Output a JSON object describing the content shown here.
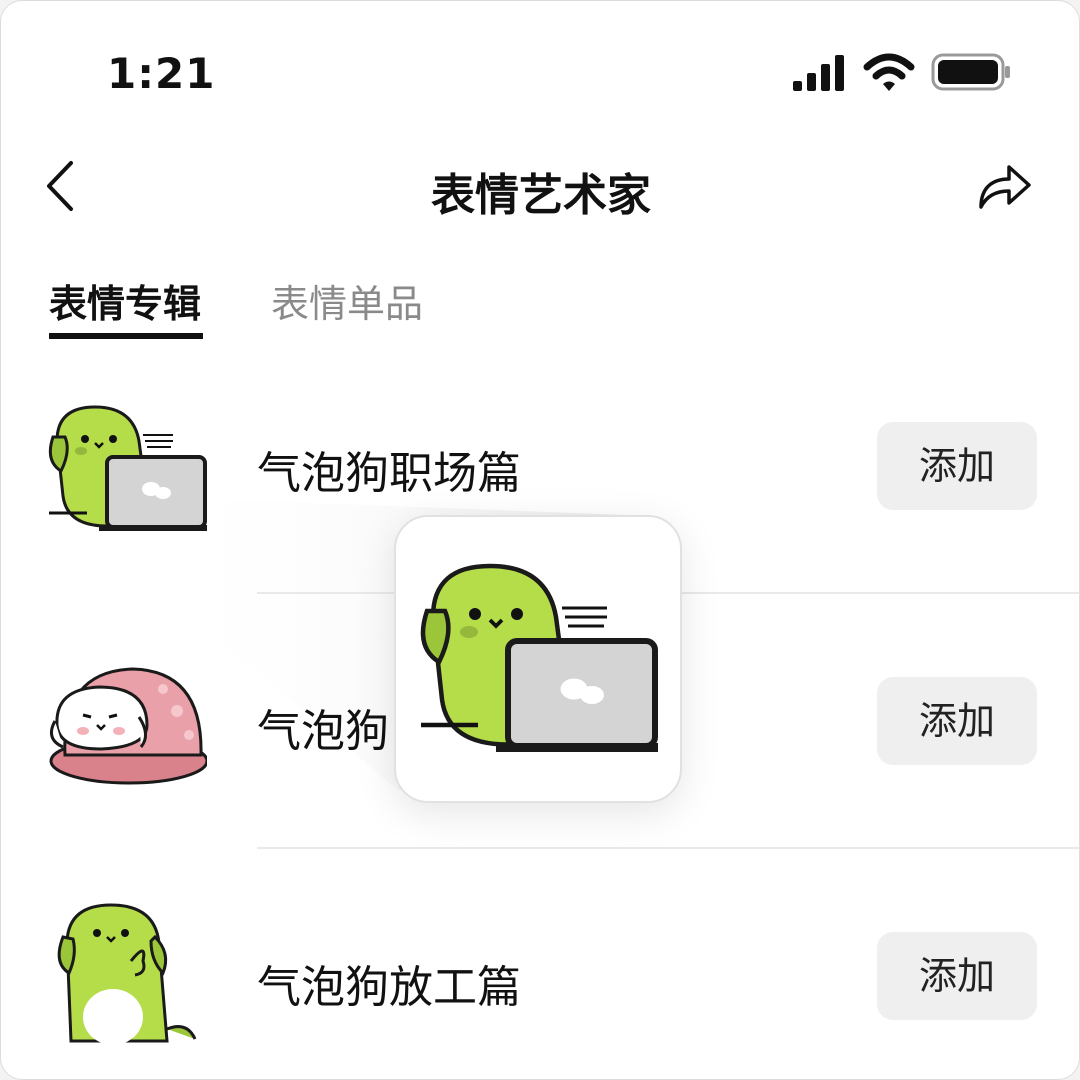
{
  "status_bar": {
    "time": "1:21",
    "icons": [
      "signal-icon",
      "wifi-icon",
      "battery-icon"
    ]
  },
  "nav": {
    "title": "表情艺术家",
    "back_icon": "chevron-left-icon",
    "share_icon": "share-arrow-icon"
  },
  "tabs": [
    {
      "label": "表情专辑",
      "active": true
    },
    {
      "label": "表情单品",
      "active": false
    }
  ],
  "albums": [
    {
      "name": "气泡狗职场篇",
      "button": "添加",
      "thumb": "green-dog-laptop"
    },
    {
      "name": "气泡狗",
      "button": "添加",
      "thumb": "white-dog-blanket"
    },
    {
      "name": "气泡狗放工篇",
      "button": "添加",
      "thumb": "green-dog-thinking"
    }
  ],
  "preview": {
    "sticker": "green-dog-laptop"
  },
  "colors": {
    "accent_text": "#111111",
    "inactive_tab": "#8a8a8a",
    "button_bg": "#efefef",
    "dog_green": "#b5dd4a",
    "blanket_pink": "#d9828c"
  }
}
